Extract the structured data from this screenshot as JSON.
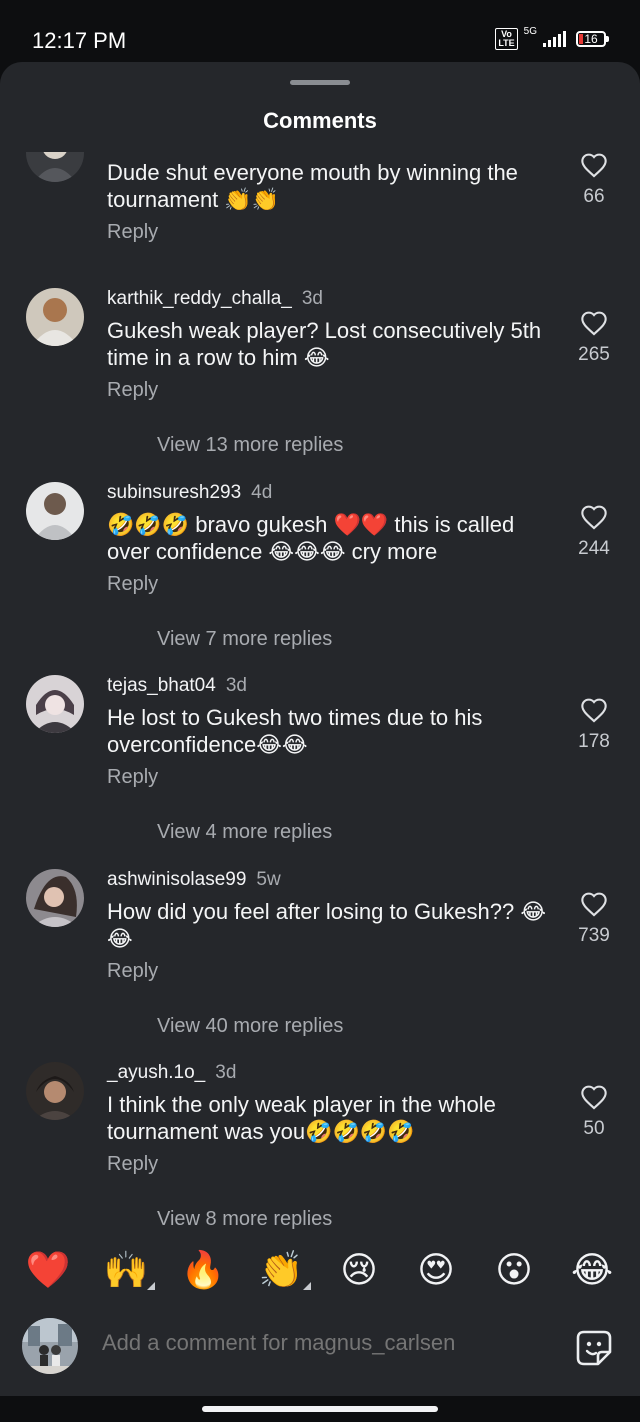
{
  "status": {
    "time": "12:17 PM",
    "network": "5G",
    "volte": "Vo LTE",
    "battery": "16"
  },
  "sheet": {
    "title": "Comments"
  },
  "comments": [
    {
      "username": "",
      "age": "",
      "text": "Dude shut everyone mouth by winning the tournament 👏👏",
      "reply": "Reply",
      "likes": "66",
      "view_more": ""
    },
    {
      "username": "karthik_reddy_challa_",
      "age": "3d",
      "text": "Gukesh weak player? Lost consecutively 5th time in a row to him 😂",
      "reply": "Reply",
      "likes": "265",
      "view_more": "View 13 more replies"
    },
    {
      "username": "subinsuresh293",
      "age": "4d",
      "text": "🤣🤣🤣 bravo gukesh ❤️❤️ this is called over confidence 😂😂😂 cry more",
      "reply": "Reply",
      "likes": "244",
      "view_more": "View 7 more replies"
    },
    {
      "username": "tejas_bhat04",
      "age": "3d",
      "text": "He lost to Gukesh two times due to his overconfidence😂😂",
      "reply": "Reply",
      "likes": "178",
      "view_more": "View 4 more replies"
    },
    {
      "username": "ashwinisolase99",
      "age": "5w",
      "text": "How did you feel after losing to Gukesh?? 😂😂",
      "reply": "Reply",
      "likes": "739",
      "view_more": "View 40 more replies"
    },
    {
      "username": "_ayush.1o_",
      "age": "3d",
      "text": "I think the only weak player in the whole tournament was you🤣🤣🤣🤣",
      "reply": "Reply",
      "likes": "50",
      "view_more": "View 8 more replies"
    }
  ],
  "quick_emojis": [
    "❤️",
    "🙌",
    "🔥",
    "👏",
    "😢",
    "😍",
    "😮",
    "😂"
  ],
  "composer": {
    "placeholder": "Add a comment for magnus_carlsen"
  },
  "icons": {
    "like": "heart-outline-icon",
    "sticker": "sticker-smile-icon"
  }
}
